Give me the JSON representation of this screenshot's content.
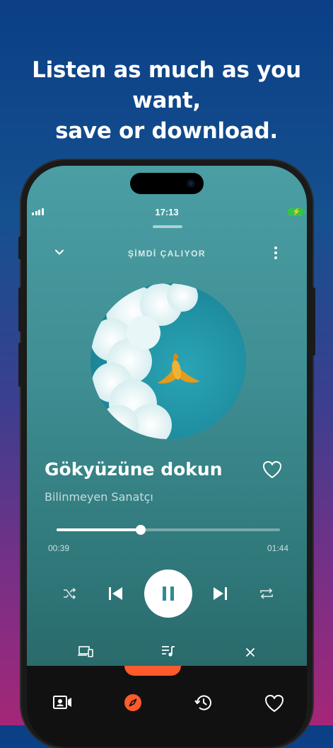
{
  "headline": {
    "line1": "Listen as much as you want,",
    "line2": "save or download."
  },
  "status_bar": {
    "time": "17:13",
    "signal_icon": "signal-icon",
    "battery_icon": "battery-charging-icon"
  },
  "player": {
    "header_title": "ŞİMDİ ÇALIYOR",
    "collapse_icon": "chevron-down-icon",
    "more_icon": "more-vertical-icon",
    "song_title": "Gökyüzüne dokun",
    "artist": "Bilinmeyen Sanatçı",
    "favorite_icon": "heart-outline-icon",
    "progress": {
      "elapsed": "00:39",
      "total": "01:44",
      "fraction": 0.375
    },
    "controls": {
      "shuffle_icon": "shuffle-icon",
      "previous_icon": "skip-previous-icon",
      "play_pause_icon": "pause-icon",
      "next_icon": "skip-next-icon",
      "repeat_icon": "repeat-icon"
    },
    "bottom_actions": {
      "devices_icon": "devices-icon",
      "queue_icon": "queue-music-icon",
      "close_icon": "close-icon"
    }
  },
  "bottom_nav": {
    "items": [
      {
        "icon": "video-contact-icon",
        "active": false
      },
      {
        "icon": "compass-icon",
        "active": true
      },
      {
        "icon": "history-icon",
        "active": false
      },
      {
        "icon": "heart-icon",
        "active": false
      }
    ]
  },
  "colors": {
    "accent": "#ff5a2b",
    "play_icon": "#2f8c91",
    "battery": "#37c24a"
  }
}
